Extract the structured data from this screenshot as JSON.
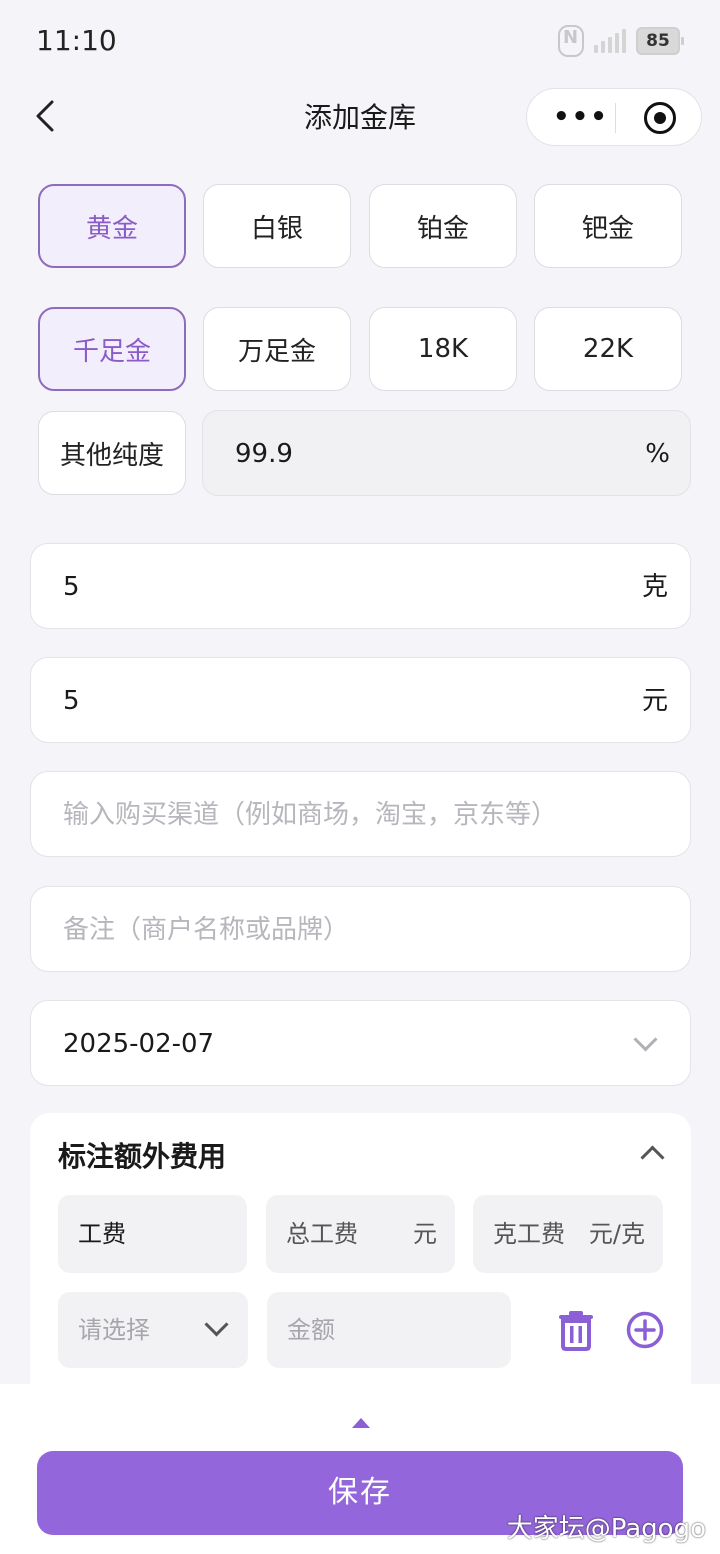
{
  "status_bar": {
    "time": "11:10",
    "battery": "85"
  },
  "nav": {
    "title": "添加金库"
  },
  "metal_types": [
    {
      "label": "黄金",
      "selected": true
    },
    {
      "label": "白银",
      "selected": false
    },
    {
      "label": "铂金",
      "selected": false
    },
    {
      "label": "钯金",
      "selected": false
    }
  ],
  "purity_options": [
    {
      "label": "千足金",
      "selected": true
    },
    {
      "label": "万足金",
      "selected": false
    },
    {
      "label": "18K",
      "selected": false
    },
    {
      "label": "22K",
      "selected": false
    }
  ],
  "other_purity": {
    "label": "其他纯度",
    "value": "99.9",
    "unit": "%"
  },
  "weight": {
    "value": "5",
    "unit": "克"
  },
  "price": {
    "value": "5",
    "unit": "元"
  },
  "channel": {
    "placeholder": "输入购买渠道（例如商场，淘宝，京东等）"
  },
  "note": {
    "placeholder": "备注（商户名称或品牌）"
  },
  "date": {
    "value": "2025-02-07"
  },
  "extra_fees": {
    "title": "标注额外费用",
    "labor_label": "工费",
    "total_labor": {
      "label": "总工费",
      "unit": "元"
    },
    "gram_labor": {
      "label": "克工费",
      "unit": "元/克"
    },
    "select_placeholder": "请选择",
    "amount_placeholder": "金额"
  },
  "save_label": "保存",
  "watermark": "大家坛@Pagogo",
  "colors": {
    "accent": "#9466db",
    "selected_bg": "#f3eefb",
    "selected_text": "#8a5cc8"
  }
}
